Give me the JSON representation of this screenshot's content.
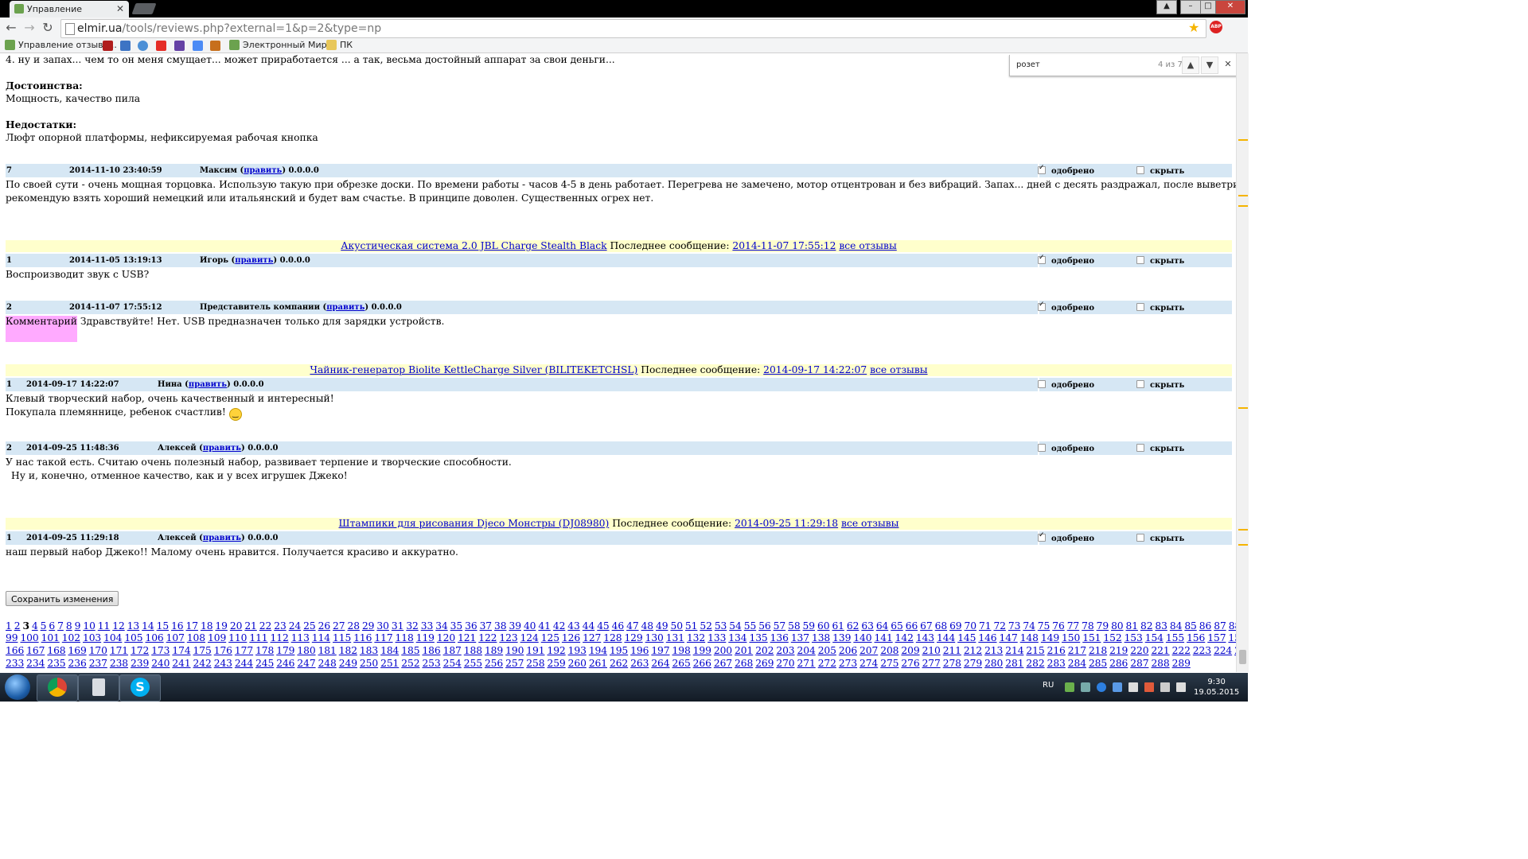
{
  "browser": {
    "tab_title": "Управление отзывами",
    "url_host": "elmir.ua",
    "url_path": "/tools/reviews.php?external=1&p=2&type=np",
    "bookmarks": [
      "Управление отзыва...",
      "Электронный Мир...",
      "ПК"
    ],
    "find": {
      "query": "розет",
      "count": "4 из 7"
    }
  },
  "page": {
    "top_fragment": "4. ну и запах... чем то он меня смущает... может приработается      ... а так, весьма достойный аппарат за свои деньги...",
    "pros_label": "Достоинства:",
    "pros_text": "Мощность, качество пила",
    "cons_label": "Недостатки:",
    "cons_text": "Люфт опорной платформы, нефиксируемая рабочая кнопка",
    "approved_label": "одобрено",
    "hide_label": "скрыть",
    "edit_label": "править",
    "last_message_label": "Последнее сообщение:",
    "all_reviews_label": "все отзывы",
    "comment_label": "Комментарий",
    "save_button": "Сохранить изменения",
    "reviews": [
      {
        "num": "7",
        "date": "2014-11-10 23:40:59",
        "author": "Максим",
        "ip": "0.0.0.0",
        "approved": true,
        "hidden": false,
        "text1": "По своей сути - очень мощная торцовка. Использую такую при обрезке доски. По времени работы - часов 4-5 в день работает. Перегрева не замечено, мотор отцентрован и без вибраций. Запах... дней с десять раздражал, после выветрился и сейчас все нормально. Диск - сразу",
        "text2": "рекомендую взять хороший немецкий или итальянский и будет вам счастье. В принципе доволен. Существенных огрех нет."
      }
    ],
    "products": [
      {
        "name": "Акустическая система 2.0 JBL Charge Stealth Black",
        "last": "2014-11-07 17:55:12",
        "reviews": [
          {
            "num": "1",
            "date": "2014-11-05 13:19:13",
            "author": "Игорь",
            "ip": "0.0.0.0",
            "approved": true,
            "hidden": false,
            "text": "Воспроизводит звук с USB?"
          },
          {
            "num": "2",
            "date": "2014-11-07 17:55:12",
            "author": "Представитель компании",
            "ip": "0.0.0.0",
            "approved": true,
            "hidden": false,
            "text": "Здравствуйте! Нет. USB предназначен только для зарядки устройств."
          }
        ]
      },
      {
        "name": "Чайник-генератор Biolite KettleCharge Silver (BILITEKETCHSL)",
        "last": "2014-09-17 14:22:07",
        "reviews": [
          {
            "num": "1",
            "date": "2014-09-17 14:22:07",
            "author": "Нина",
            "ip": "0.0.0.0",
            "approved": false,
            "hidden": false,
            "text": "Клевый творческий набор, очень качественный и интересный!",
            "text2": "Покупала племяннице, ребенок счастлив!"
          },
          {
            "num": "2",
            "date": "2014-09-25 11:48:36",
            "author": "Алексей",
            "ip": "0.0.0.0",
            "approved": false,
            "hidden": false,
            "text": "У нас такой есть. Считаю очень полезный набор, развивает терпение и творческие способности.",
            "text2": "Ну и, конечно, отменное качество, как и у всех игрушек Джеко!"
          }
        ]
      },
      {
        "name": "Штампики для рисования Djeco Монстры (DJ08980)",
        "last": "2014-09-25 11:29:18",
        "reviews": [
          {
            "num": "1",
            "date": "2014-09-25 11:29:18",
            "author": "Алексей",
            "ip": "0.0.0.0",
            "approved": true,
            "hidden": false,
            "text": "наш первый набор Джеко!! Малому очень нравится. Получается красиво и аккуратно."
          }
        ]
      }
    ],
    "pagination": {
      "current": 3,
      "total": 289
    }
  },
  "taskbar": {
    "lang": "RU",
    "time": "9:30",
    "date": "19.05.2015"
  }
}
